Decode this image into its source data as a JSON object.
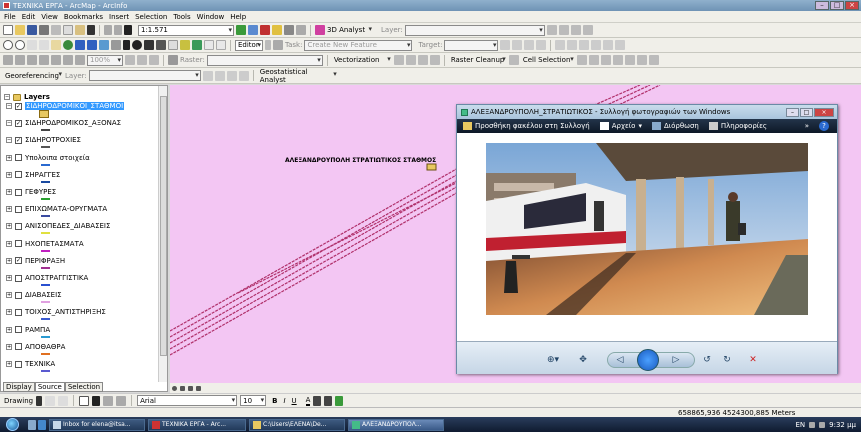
{
  "window": {
    "title": "ΤΕΧΝΙΚΑ ΕΡΓΑ - ArcMap - ArcInfo"
  },
  "menu": [
    "File",
    "Edit",
    "View",
    "Bookmarks",
    "Insert",
    "Selection",
    "Tools",
    "Window",
    "Help"
  ],
  "toolbar": {
    "scale": "1:1.571",
    "analyst": "3D Analyst",
    "layer_label": "Layer:",
    "editor": "Editor",
    "task_label": "Task:",
    "task_value": "Create New Feature",
    "target_label": "Target:",
    "zoom_pct": "100%",
    "raster_label": "Raster:",
    "georeferencing": "Georeferencing",
    "geostat": "Geostatistical Analyst",
    "vectorization": "Vectorization",
    "raster_cleanup": "Raster Cleanup",
    "cell_selection": "Cell Selection"
  },
  "toc": {
    "root": "Layers",
    "layers": [
      {
        "name": "ΣΙΔΗΡΟΔΡΟΜΙΚΟΙ_ΣΤΑΘΜΟΙ",
        "checked": true,
        "sym": "#c8a020",
        "selected": true
      },
      {
        "name": "ΣΙΔΗΡΟΔΡΟΜΙΚΟΣ_ΑΞΟΝΑΣ",
        "checked": true,
        "sym": "#444444"
      },
      {
        "name": "ΣΙΔΗΡΟΤΡΟΧΙΕΣ",
        "checked": true,
        "sym": "#555555"
      },
      {
        "name": "Υπολοιπα στοιχεία",
        "checked": false,
        "sym": "#2a6ad0"
      },
      {
        "name": "ΣΗΡΑΓΓΕΣ",
        "checked": false,
        "sym": "#1a4aa0"
      },
      {
        "name": "ΓΕΦΥΡΕΣ",
        "checked": false,
        "sym": "#2aa030"
      },
      {
        "name": "ΕΠΙΧΩΜΑΤΑ-ΟΡΥΓΜΑΤΑ",
        "checked": false,
        "sym": "#3a4aa0"
      },
      {
        "name": "ΑΝΙΣΟΠΕΔΕΣ_ΔΙΑΒΑΣΕΙΣ",
        "checked": false,
        "sym": "#e0e040"
      },
      {
        "name": "ΗΧΟΠΕΤΑΣΜΑΤΑ",
        "checked": false,
        "sym": "#c020c0"
      },
      {
        "name": "ΠΕΡΙΦΡΑΞΗ",
        "checked": true,
        "sym": "#a03090"
      },
      {
        "name": "ΑΠΟΣΤΡΑΓΓΙΣΤΙΚΑ",
        "checked": false,
        "sym": "#2a50d0"
      },
      {
        "name": "ΔΙΑΒΑΣΕΙΣ",
        "checked": false,
        "sym": "#e0a0e0"
      },
      {
        "name": "ΤΟΙΧΟΣ_ΑΝΤΙΣΤΗΡΙΞΗΣ",
        "checked": false,
        "sym": "#3a5ad0"
      },
      {
        "name": "ΡΑΜΠΑ",
        "checked": false,
        "sym": "#2a9ad0"
      },
      {
        "name": "ΑΠΟΘΑΘΡΑ",
        "checked": false,
        "sym": "#e07020"
      },
      {
        "name": "ΤΕΧΝΙΚΑ",
        "checked": false,
        "sym": "#5a5ad0"
      }
    ],
    "tabs": [
      "Display",
      "Source",
      "Selection"
    ]
  },
  "map": {
    "label": "ΑΛΕΞΑΝΔΡΟΥΠΟΛΗ ΣΤΡΑΤΙΩΤΙΚΟΣ ΣΤΑΘΜΟΣ",
    "bg": "#f3c6f3",
    "line_color": "#b0306a"
  },
  "drawing": {
    "label": "Drawing",
    "font": "Arial",
    "size": "10",
    "bold": "B",
    "italic": "I",
    "underline": "U",
    "fontcolor": "A"
  },
  "status": {
    "coords": "658865,936  4524300,885 Meters"
  },
  "photo_viewer": {
    "title": "ΑΛΕΞΑΝΔΡΟΥΠΟΛΗ_ΣΤΡΑΤΙΩΤΙΚΟΣ - Συλλογή φωτογραφιών των Windows",
    "toolbar": [
      "Προσθήκη φακέλου στη Συλλογή",
      "Αρχείο",
      "Διόρθωση",
      "Πληροφορίες"
    ],
    "more": "»",
    "help": "?"
  },
  "taskbar": {
    "tasks": [
      {
        "label": "Inbox for elena@itsa...",
        "active": false
      },
      {
        "label": "ΤΕΧΝΙΚΑ ΕΡΓΑ - Arc...",
        "active": false
      },
      {
        "label": "C:\\Users\\ΕΛΕΝΑ\\De...",
        "active": false
      },
      {
        "label": "ΑΛΕΞΑΝΔΡΟΥΠΟΛ...",
        "active": true
      }
    ],
    "lang": "EN",
    "time": "9:32 μμ"
  }
}
